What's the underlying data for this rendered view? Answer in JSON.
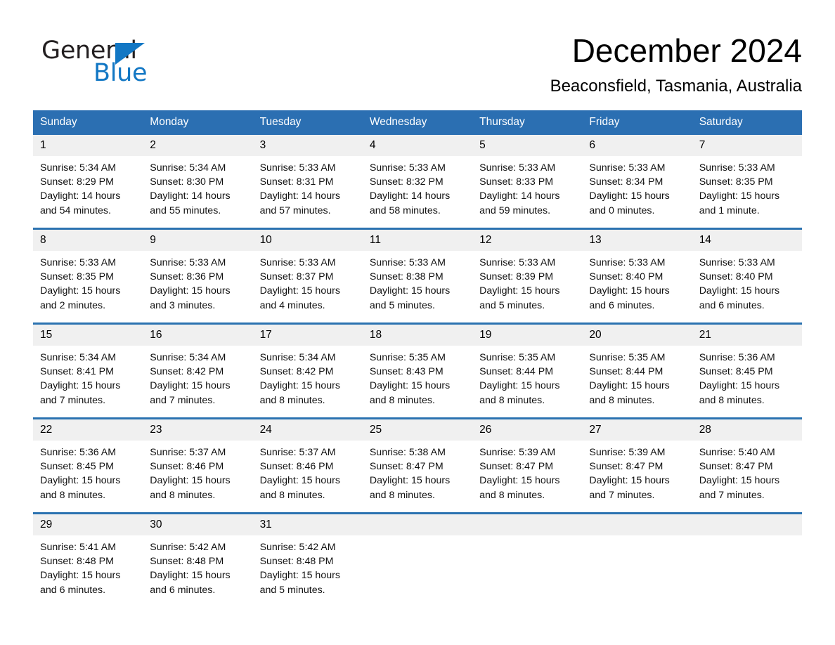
{
  "brand": {
    "name_part1": "General",
    "name_part2": "Blue",
    "flag_icon": "triangle-flag-icon",
    "accent_color": "#1277c4"
  },
  "header": {
    "month_title": "December 2024",
    "location": "Beaconsfield, Tasmania, Australia"
  },
  "theme": {
    "header_blue": "#2b6fb2",
    "row_divider_blue": "#2b72b0",
    "daynum_band": "#f0f0f0",
    "page_background": "#ffffff"
  },
  "calendar": {
    "weekday_headers": [
      "Sunday",
      "Monday",
      "Tuesday",
      "Wednesday",
      "Thursday",
      "Friday",
      "Saturday"
    ],
    "weeks": [
      [
        {
          "day": "1",
          "sunrise": "Sunrise: 5:34 AM",
          "sunset": "Sunset: 8:29 PM",
          "daylight_line1": "Daylight: 14 hours",
          "daylight_line2": "and 54 minutes."
        },
        {
          "day": "2",
          "sunrise": "Sunrise: 5:34 AM",
          "sunset": "Sunset: 8:30 PM",
          "daylight_line1": "Daylight: 14 hours",
          "daylight_line2": "and 55 minutes."
        },
        {
          "day": "3",
          "sunrise": "Sunrise: 5:33 AM",
          "sunset": "Sunset: 8:31 PM",
          "daylight_line1": "Daylight: 14 hours",
          "daylight_line2": "and 57 minutes."
        },
        {
          "day": "4",
          "sunrise": "Sunrise: 5:33 AM",
          "sunset": "Sunset: 8:32 PM",
          "daylight_line1": "Daylight: 14 hours",
          "daylight_line2": "and 58 minutes."
        },
        {
          "day": "5",
          "sunrise": "Sunrise: 5:33 AM",
          "sunset": "Sunset: 8:33 PM",
          "daylight_line1": "Daylight: 14 hours",
          "daylight_line2": "and 59 minutes."
        },
        {
          "day": "6",
          "sunrise": "Sunrise: 5:33 AM",
          "sunset": "Sunset: 8:34 PM",
          "daylight_line1": "Daylight: 15 hours",
          "daylight_line2": "and 0 minutes."
        },
        {
          "day": "7",
          "sunrise": "Sunrise: 5:33 AM",
          "sunset": "Sunset: 8:35 PM",
          "daylight_line1": "Daylight: 15 hours",
          "daylight_line2": "and 1 minute."
        }
      ],
      [
        {
          "day": "8",
          "sunrise": "Sunrise: 5:33 AM",
          "sunset": "Sunset: 8:35 PM",
          "daylight_line1": "Daylight: 15 hours",
          "daylight_line2": "and 2 minutes."
        },
        {
          "day": "9",
          "sunrise": "Sunrise: 5:33 AM",
          "sunset": "Sunset: 8:36 PM",
          "daylight_line1": "Daylight: 15 hours",
          "daylight_line2": "and 3 minutes."
        },
        {
          "day": "10",
          "sunrise": "Sunrise: 5:33 AM",
          "sunset": "Sunset: 8:37 PM",
          "daylight_line1": "Daylight: 15 hours",
          "daylight_line2": "and 4 minutes."
        },
        {
          "day": "11",
          "sunrise": "Sunrise: 5:33 AM",
          "sunset": "Sunset: 8:38 PM",
          "daylight_line1": "Daylight: 15 hours",
          "daylight_line2": "and 5 minutes."
        },
        {
          "day": "12",
          "sunrise": "Sunrise: 5:33 AM",
          "sunset": "Sunset: 8:39 PM",
          "daylight_line1": "Daylight: 15 hours",
          "daylight_line2": "and 5 minutes."
        },
        {
          "day": "13",
          "sunrise": "Sunrise: 5:33 AM",
          "sunset": "Sunset: 8:40 PM",
          "daylight_line1": "Daylight: 15 hours",
          "daylight_line2": "and 6 minutes."
        },
        {
          "day": "14",
          "sunrise": "Sunrise: 5:33 AM",
          "sunset": "Sunset: 8:40 PM",
          "daylight_line1": "Daylight: 15 hours",
          "daylight_line2": "and 6 minutes."
        }
      ],
      [
        {
          "day": "15",
          "sunrise": "Sunrise: 5:34 AM",
          "sunset": "Sunset: 8:41 PM",
          "daylight_line1": "Daylight: 15 hours",
          "daylight_line2": "and 7 minutes."
        },
        {
          "day": "16",
          "sunrise": "Sunrise: 5:34 AM",
          "sunset": "Sunset: 8:42 PM",
          "daylight_line1": "Daylight: 15 hours",
          "daylight_line2": "and 7 minutes."
        },
        {
          "day": "17",
          "sunrise": "Sunrise: 5:34 AM",
          "sunset": "Sunset: 8:42 PM",
          "daylight_line1": "Daylight: 15 hours",
          "daylight_line2": "and 8 minutes."
        },
        {
          "day": "18",
          "sunrise": "Sunrise: 5:35 AM",
          "sunset": "Sunset: 8:43 PM",
          "daylight_line1": "Daylight: 15 hours",
          "daylight_line2": "and 8 minutes."
        },
        {
          "day": "19",
          "sunrise": "Sunrise: 5:35 AM",
          "sunset": "Sunset: 8:44 PM",
          "daylight_line1": "Daylight: 15 hours",
          "daylight_line2": "and 8 minutes."
        },
        {
          "day": "20",
          "sunrise": "Sunrise: 5:35 AM",
          "sunset": "Sunset: 8:44 PM",
          "daylight_line1": "Daylight: 15 hours",
          "daylight_line2": "and 8 minutes."
        },
        {
          "day": "21",
          "sunrise": "Sunrise: 5:36 AM",
          "sunset": "Sunset: 8:45 PM",
          "daylight_line1": "Daylight: 15 hours",
          "daylight_line2": "and 8 minutes."
        }
      ],
      [
        {
          "day": "22",
          "sunrise": "Sunrise: 5:36 AM",
          "sunset": "Sunset: 8:45 PM",
          "daylight_line1": "Daylight: 15 hours",
          "daylight_line2": "and 8 minutes."
        },
        {
          "day": "23",
          "sunrise": "Sunrise: 5:37 AM",
          "sunset": "Sunset: 8:46 PM",
          "daylight_line1": "Daylight: 15 hours",
          "daylight_line2": "and 8 minutes."
        },
        {
          "day": "24",
          "sunrise": "Sunrise: 5:37 AM",
          "sunset": "Sunset: 8:46 PM",
          "daylight_line1": "Daylight: 15 hours",
          "daylight_line2": "and 8 minutes."
        },
        {
          "day": "25",
          "sunrise": "Sunrise: 5:38 AM",
          "sunset": "Sunset: 8:47 PM",
          "daylight_line1": "Daylight: 15 hours",
          "daylight_line2": "and 8 minutes."
        },
        {
          "day": "26",
          "sunrise": "Sunrise: 5:39 AM",
          "sunset": "Sunset: 8:47 PM",
          "daylight_line1": "Daylight: 15 hours",
          "daylight_line2": "and 8 minutes."
        },
        {
          "day": "27",
          "sunrise": "Sunrise: 5:39 AM",
          "sunset": "Sunset: 8:47 PM",
          "daylight_line1": "Daylight: 15 hours",
          "daylight_line2": "and 7 minutes."
        },
        {
          "day": "28",
          "sunrise": "Sunrise: 5:40 AM",
          "sunset": "Sunset: 8:47 PM",
          "daylight_line1": "Daylight: 15 hours",
          "daylight_line2": "and 7 minutes."
        }
      ],
      [
        {
          "day": "29",
          "sunrise": "Sunrise: 5:41 AM",
          "sunset": "Sunset: 8:48 PM",
          "daylight_line1": "Daylight: 15 hours",
          "daylight_line2": "and 6 minutes."
        },
        {
          "day": "30",
          "sunrise": "Sunrise: 5:42 AM",
          "sunset": "Sunset: 8:48 PM",
          "daylight_line1": "Daylight: 15 hours",
          "daylight_line2": "and 6 minutes."
        },
        {
          "day": "31",
          "sunrise": "Sunrise: 5:42 AM",
          "sunset": "Sunset: 8:48 PM",
          "daylight_line1": "Daylight: 15 hours",
          "daylight_line2": "and 5 minutes."
        },
        {
          "day": "",
          "sunrise": "",
          "sunset": "",
          "daylight_line1": "",
          "daylight_line2": ""
        },
        {
          "day": "",
          "sunrise": "",
          "sunset": "",
          "daylight_line1": "",
          "daylight_line2": ""
        },
        {
          "day": "",
          "sunrise": "",
          "sunset": "",
          "daylight_line1": "",
          "daylight_line2": ""
        },
        {
          "day": "",
          "sunrise": "",
          "sunset": "",
          "daylight_line1": "",
          "daylight_line2": ""
        }
      ]
    ]
  }
}
